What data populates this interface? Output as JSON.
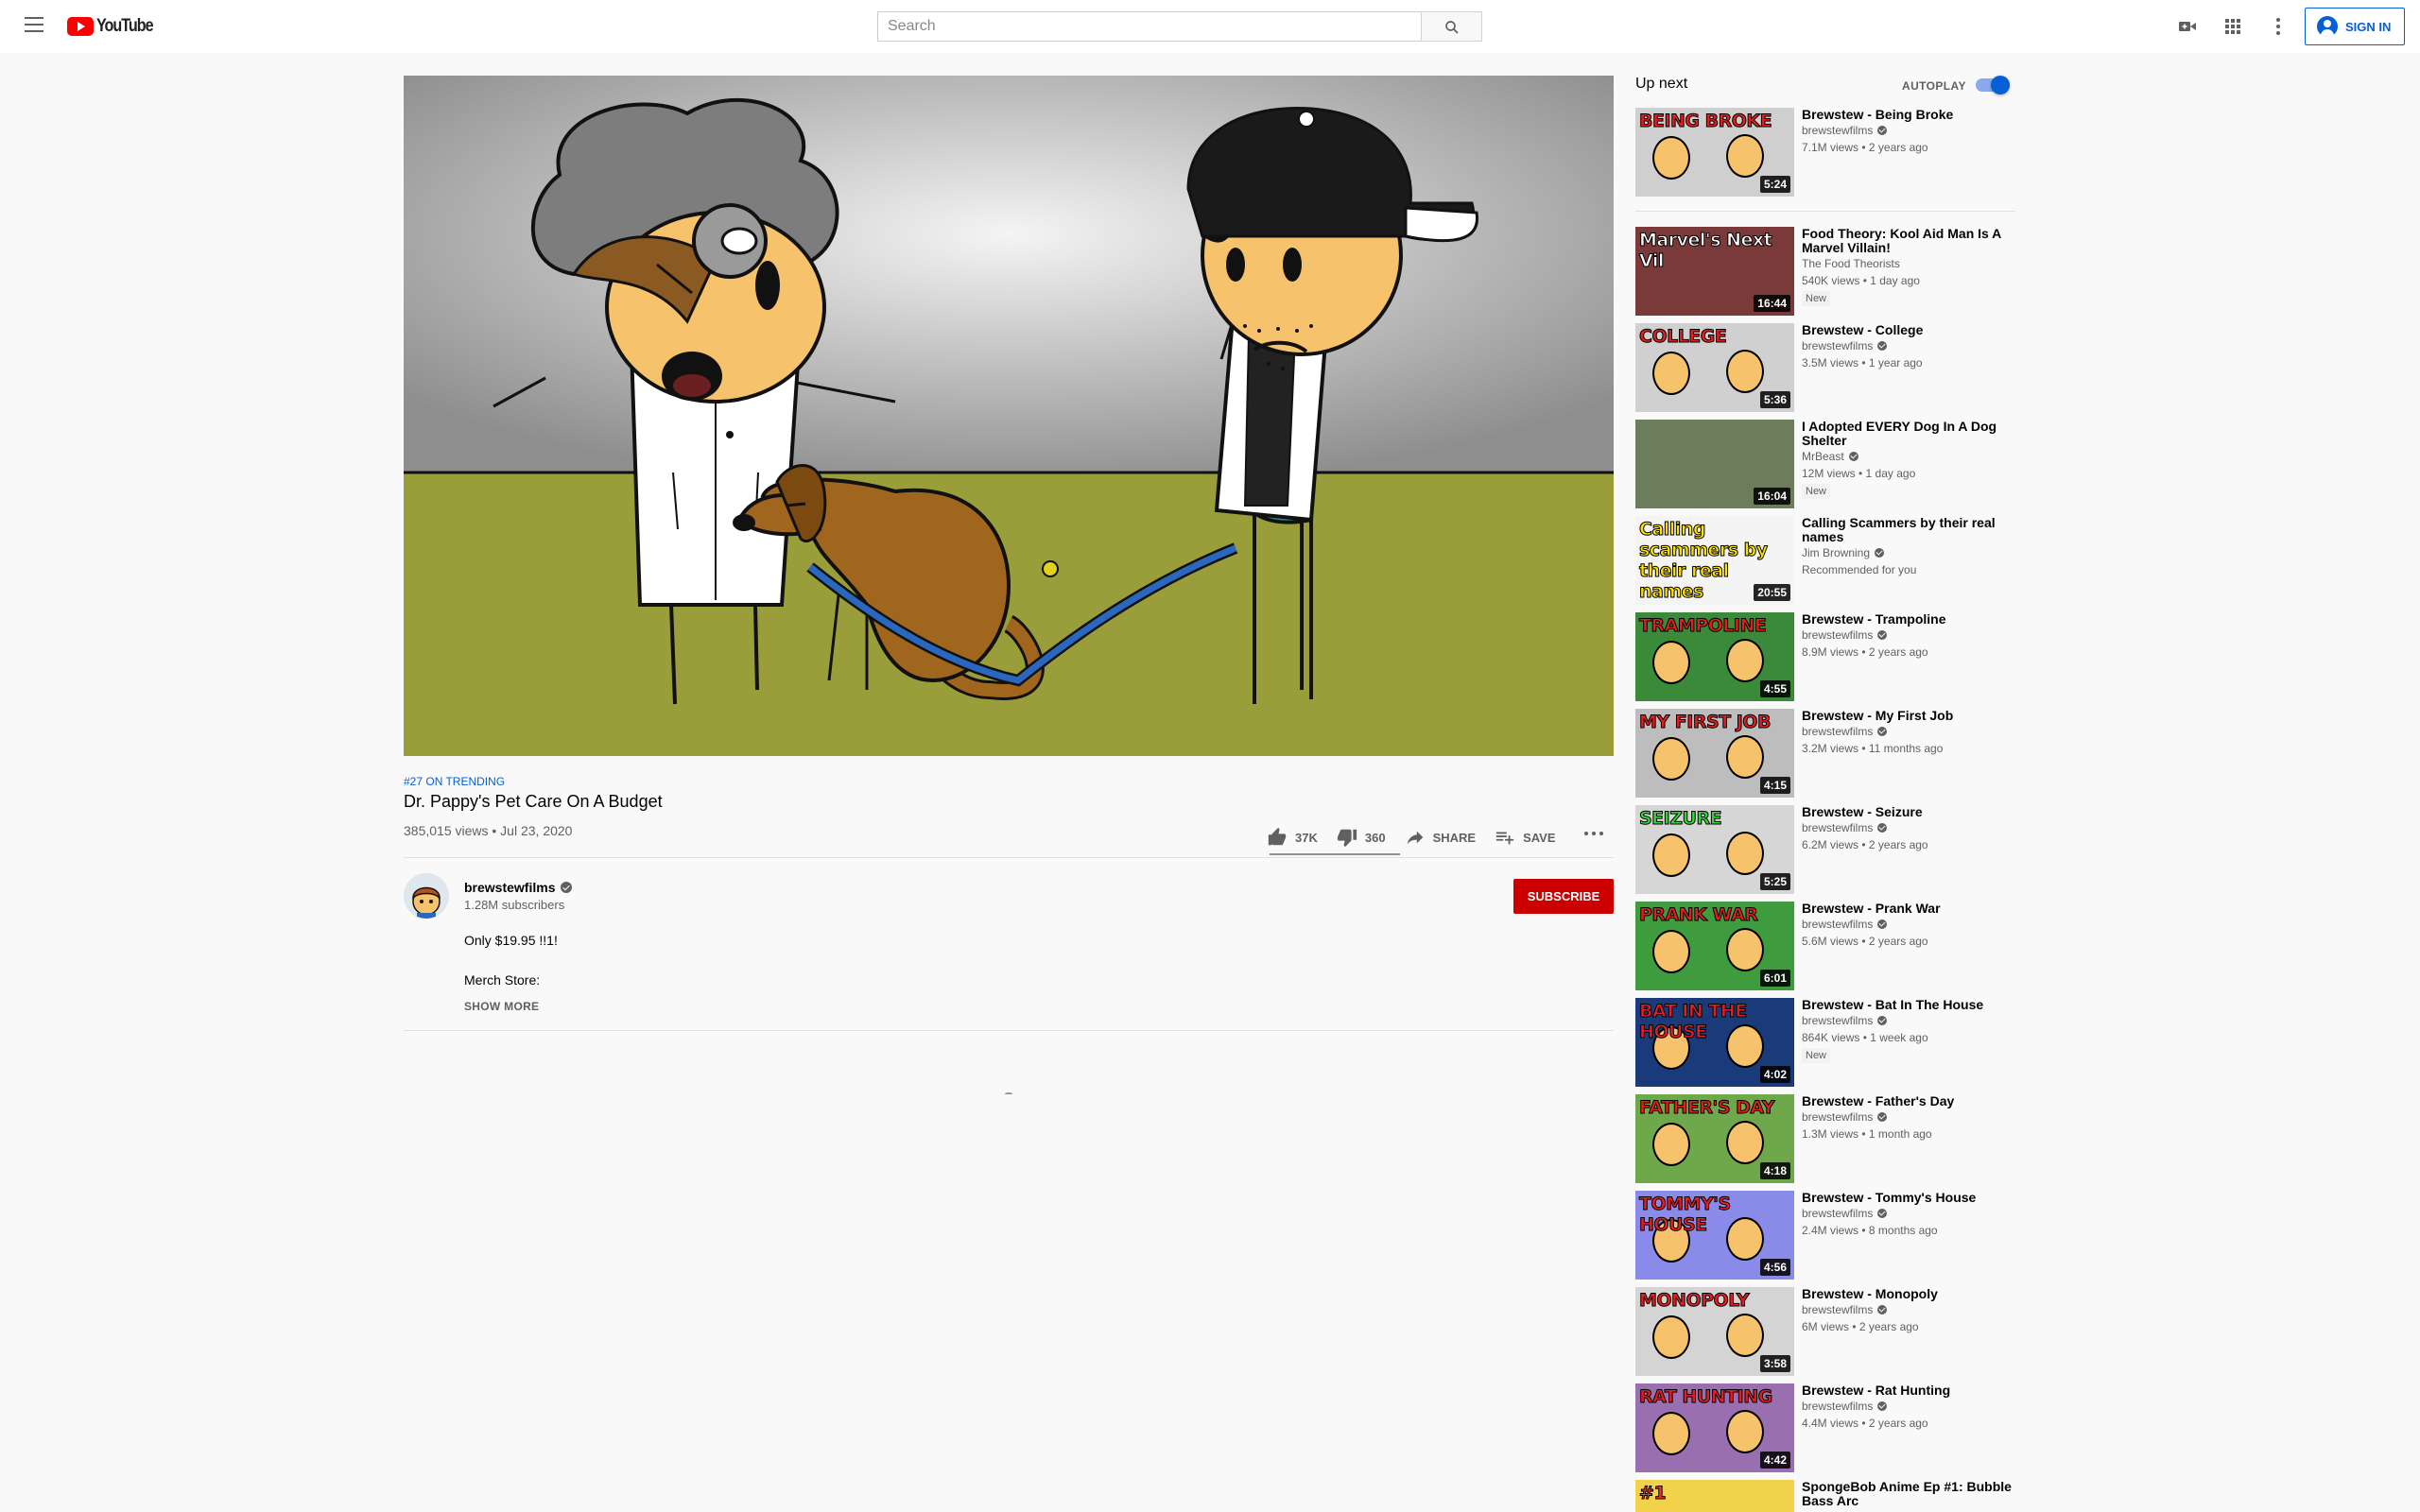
{
  "header": {
    "logo_text": "YouTube",
    "search_placeholder": "Search",
    "signin_label": "SIGN IN"
  },
  "video": {
    "trending": "#27 ON TRENDING",
    "title": "Dr. Pappy's Pet Care On A Budget",
    "meta": "385,015 views • Jul 23, 2020",
    "likes": "37K",
    "dislikes": "360",
    "like_fraction": 0.99,
    "share_label": "SHARE",
    "save_label": "SAVE"
  },
  "channel": {
    "name": "brewstewfilms",
    "subscribers": "1.28M subscribers",
    "subscribe_label": "SUBSCRIBE"
  },
  "description": {
    "line1": "Only $19.95 !!1!",
    "line2": "Merch Store:",
    "show_more": "SHOW MORE"
  },
  "sidebar": {
    "up_next_label": "Up next",
    "autoplay_label": "AUTOPLAY",
    "autoplay_on": true,
    "videos": [
      {
        "title": "Brewstew - Being Broke",
        "channel": "brewstewfilms",
        "verified": true,
        "meta": "7.1M views • 2 years ago",
        "duration": "5:24",
        "thumb_text": "BEING BROKE",
        "thumb_color": "#e02020",
        "bg": "#cfcfcf"
      },
      {
        "title": "Food Theory: Kool Aid Man Is A Marvel Villain!",
        "channel": "The Food Theorists",
        "verified": false,
        "meta": "540K views • 1 day ago",
        "badge": "New",
        "duration": "16:44",
        "thumb_text": "Marvel's Next Vil",
        "thumb_color": "#ffffff",
        "bg": "#7a3a3a"
      },
      {
        "title": "Brewstew - College",
        "channel": "brewstewfilms",
        "verified": true,
        "meta": "3.5M views • 1 year ago",
        "duration": "5:36",
        "thumb_text": "COLLEGE",
        "thumb_color": "#e02020",
        "bg": "#d0d0d0"
      },
      {
        "title": "I Adopted EVERY Dog In A Dog Shelter",
        "channel": "MrBeast",
        "verified": true,
        "meta": "12M views • 1 day ago",
        "badge": "New",
        "duration": "16:04",
        "thumb_text": "",
        "thumb_color": "#ffffff",
        "bg": "#6b7d5a"
      },
      {
        "title": "Calling Scammers by their real names",
        "channel": "Jim Browning",
        "verified": true,
        "meta": "Recommended for you",
        "duration": "20:55",
        "thumb_text": "Calling scammers by their real names",
        "thumb_color": "#ffe000",
        "bg": "#f4f4f4"
      },
      {
        "title": "Brewstew - Trampoline",
        "channel": "brewstewfilms",
        "verified": true,
        "meta": "8.9M views • 2 years ago",
        "duration": "4:55",
        "thumb_text": "TRAMPOLINE",
        "thumb_color": "#e02020",
        "bg": "#3a8a3a"
      },
      {
        "title": "Brewstew - My First Job",
        "channel": "brewstewfilms",
        "verified": true,
        "meta": "3.2M views • 11 months ago",
        "duration": "4:15",
        "thumb_text": "MY FIRST JOB",
        "thumb_color": "#e02020",
        "bg": "#bdbdbd"
      },
      {
        "title": "Brewstew - Seizure",
        "channel": "brewstewfilms",
        "verified": true,
        "meta": "6.2M views • 2 years ago",
        "duration": "5:25",
        "thumb_text": "SEIZURE",
        "thumb_color": "#3ad23a",
        "bg": "#d6d6d6"
      },
      {
        "title": "Brewstew - Prank War",
        "channel": "brewstewfilms",
        "verified": true,
        "meta": "5.6M views • 2 years ago",
        "duration": "6:01",
        "thumb_text": "PRANK WAR",
        "thumb_color": "#e02020",
        "bg": "#3e9c3e"
      },
      {
        "title": "Brewstew - Bat In The House",
        "channel": "brewstewfilms",
        "verified": true,
        "meta": "864K views • 1 week ago",
        "badge": "New",
        "duration": "4:02",
        "thumb_text": "BAT IN THE HOUSE",
        "thumb_color": "#e02020",
        "bg": "#1a3a7a"
      },
      {
        "title": "Brewstew - Father's Day",
        "channel": "brewstewfilms",
        "verified": true,
        "meta": "1.3M views • 1 month ago",
        "duration": "4:18",
        "thumb_text": "FATHER'S DAY",
        "thumb_color": "#e02020",
        "bg": "#6fa84a"
      },
      {
        "title": "Brewstew - Tommy's House",
        "channel": "brewstewfilms",
        "verified": true,
        "meta": "2.4M views • 8 months ago",
        "duration": "4:56",
        "thumb_text": "TOMMY'S HOUSE",
        "thumb_color": "#e02020",
        "bg": "#8a8ae8"
      },
      {
        "title": "Brewstew - Monopoly",
        "channel": "brewstewfilms",
        "verified": true,
        "meta": "6M views • 2 years ago",
        "duration": "3:58",
        "thumb_text": "MONOPOLY",
        "thumb_color": "#e02020",
        "bg": "#d4d4d4"
      },
      {
        "title": "Brewstew - Rat Hunting",
        "channel": "brewstewfilms",
        "verified": true,
        "meta": "4.4M views • 2 years ago",
        "duration": "4:42",
        "thumb_text": "RAT HUNTING",
        "thumb_color": "#e02020",
        "bg": "#9a6fb0"
      },
      {
        "title": "SpongeBob Anime Ep #1: Bubble Bass Arc",
        "channel": "",
        "verified": false,
        "meta": "",
        "duration": "",
        "thumb_text": "#1",
        "thumb_color": "#ff3030",
        "bg": "#f2d24a"
      }
    ]
  }
}
